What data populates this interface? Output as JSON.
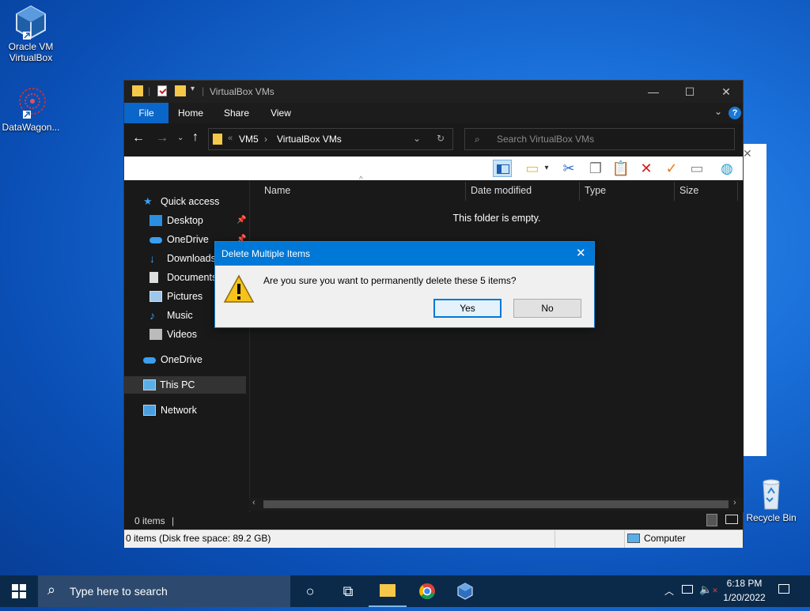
{
  "desktop": {
    "icons": [
      {
        "label_line1": "Oracle VM",
        "label_line2": "VirtualBox",
        "icon": "virtualbox-icon"
      },
      {
        "label_line1": "DataWagon...",
        "label_line2": "",
        "icon": "datawagon-icon"
      },
      {
        "label_line1": "Recycle Bin",
        "label_line2": "",
        "icon": "recycle-bin-icon"
      }
    ]
  },
  "explorer": {
    "title": "VirtualBox VMs",
    "tabs": [
      "File",
      "Home",
      "Share",
      "View"
    ],
    "breadcrumb": [
      "VM5",
      "VirtualBox VMs"
    ],
    "breadcrumb_overflow": "«",
    "search_placeholder": "Search VirtualBox VMs",
    "columns": [
      "Name",
      "Date modified",
      "Type",
      "Size"
    ],
    "empty_message": "This folder is empty.",
    "nav": {
      "quick_access": "Quick access",
      "desktop": "Desktop",
      "onedrive_qa": "OneDrive",
      "downloads": "Downloads",
      "documents": "Documents",
      "pictures": "Pictures",
      "music": "Music",
      "videos": "Videos",
      "onedrive": "OneDrive",
      "this_pc": "This PC",
      "network": "Network"
    },
    "status_items": "0 items",
    "status_disk": "0 items (Disk free space: 89.2 GB)",
    "status_location": "Computer"
  },
  "dialog": {
    "title": "Delete Multiple Items",
    "message": "Are you sure you want to permanently delete these 5 items?",
    "yes_label": "Yes",
    "no_label": "No"
  },
  "taskbar": {
    "search_placeholder": "Type here to search",
    "time": "6:18 PM",
    "date": "1/20/2022"
  },
  "colors": {
    "accent": "#0078d7",
    "explorer_bg": "#191919",
    "taskbar_bg": "#0b2a4a"
  }
}
